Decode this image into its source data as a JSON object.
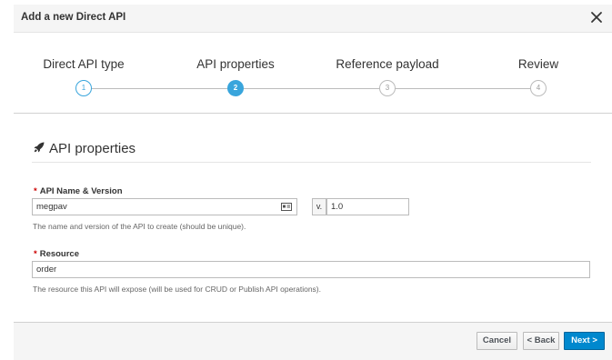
{
  "dialog": {
    "title": "Add a new Direct API"
  },
  "wizard": {
    "steps": [
      {
        "label": "Direct API type",
        "number": "1"
      },
      {
        "label": "API properties",
        "number": "2"
      },
      {
        "label": "Reference payload",
        "number": "3"
      },
      {
        "label": "Review",
        "number": "4"
      }
    ],
    "active_step": 2
  },
  "section": {
    "title": "API properties",
    "icon": "rocket-icon"
  },
  "form": {
    "required_marker": "*",
    "name_version": {
      "label": "API Name & Version",
      "value": "megpav",
      "version_prefix": "v.",
      "version_value": "1.0",
      "help": "The name and version of the API to create (should be unique)."
    },
    "resource": {
      "label": "Resource",
      "value": "order",
      "help": "The resource this API will expose (will be used for CRUD or Publish API operations)."
    }
  },
  "footer": {
    "cancel_label": "Cancel",
    "back_label": "< Back",
    "next_label": "Next >"
  },
  "colors": {
    "accent": "#39a5dc",
    "primary_button": "#0088ce",
    "required": "#cc0000"
  }
}
